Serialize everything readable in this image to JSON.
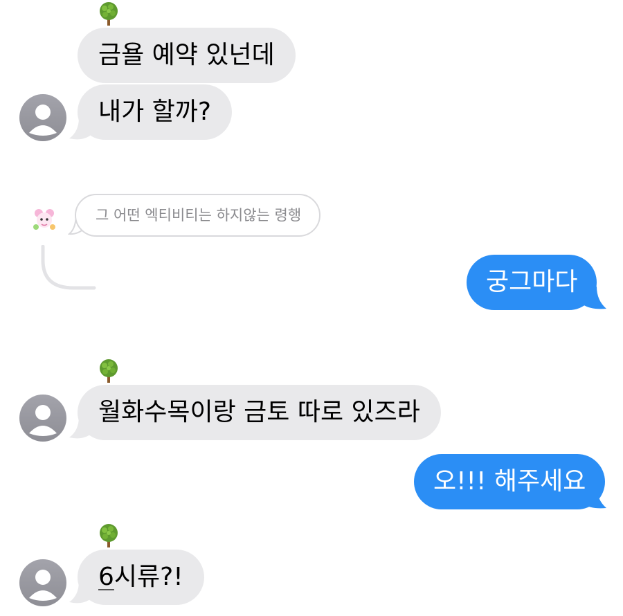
{
  "messages": [
    {
      "id": "m1",
      "from": "them",
      "text": "금욜 예약 있넌데",
      "reaction": "tree-emoji"
    },
    {
      "id": "m2",
      "from": "them",
      "text": "내가 할까?"
    },
    {
      "id": "m3",
      "from": "reply",
      "text": "그 어떤 엑티비티는 하지않는 령행"
    },
    {
      "id": "m4",
      "from": "me",
      "text": "궁그마다"
    },
    {
      "id": "m5",
      "from": "them",
      "text": "월화수목이랑 금토 따로 있즈라",
      "reaction": "tree-emoji"
    },
    {
      "id": "m6",
      "from": "me",
      "text": "오!!! 해주세요"
    },
    {
      "id": "m7",
      "from": "them",
      "text_underlined": "6",
      "text_rest": "시류?!",
      "reaction": "tree-emoji"
    }
  ],
  "colors": {
    "received_bubble": "#e9e9eb",
    "sent_bubble": "#2b8ef5",
    "avatar": "#9a9aa0"
  },
  "icons": [
    "tree-emoji",
    "person-avatar-icon",
    "sticker-avatar-icon"
  ]
}
